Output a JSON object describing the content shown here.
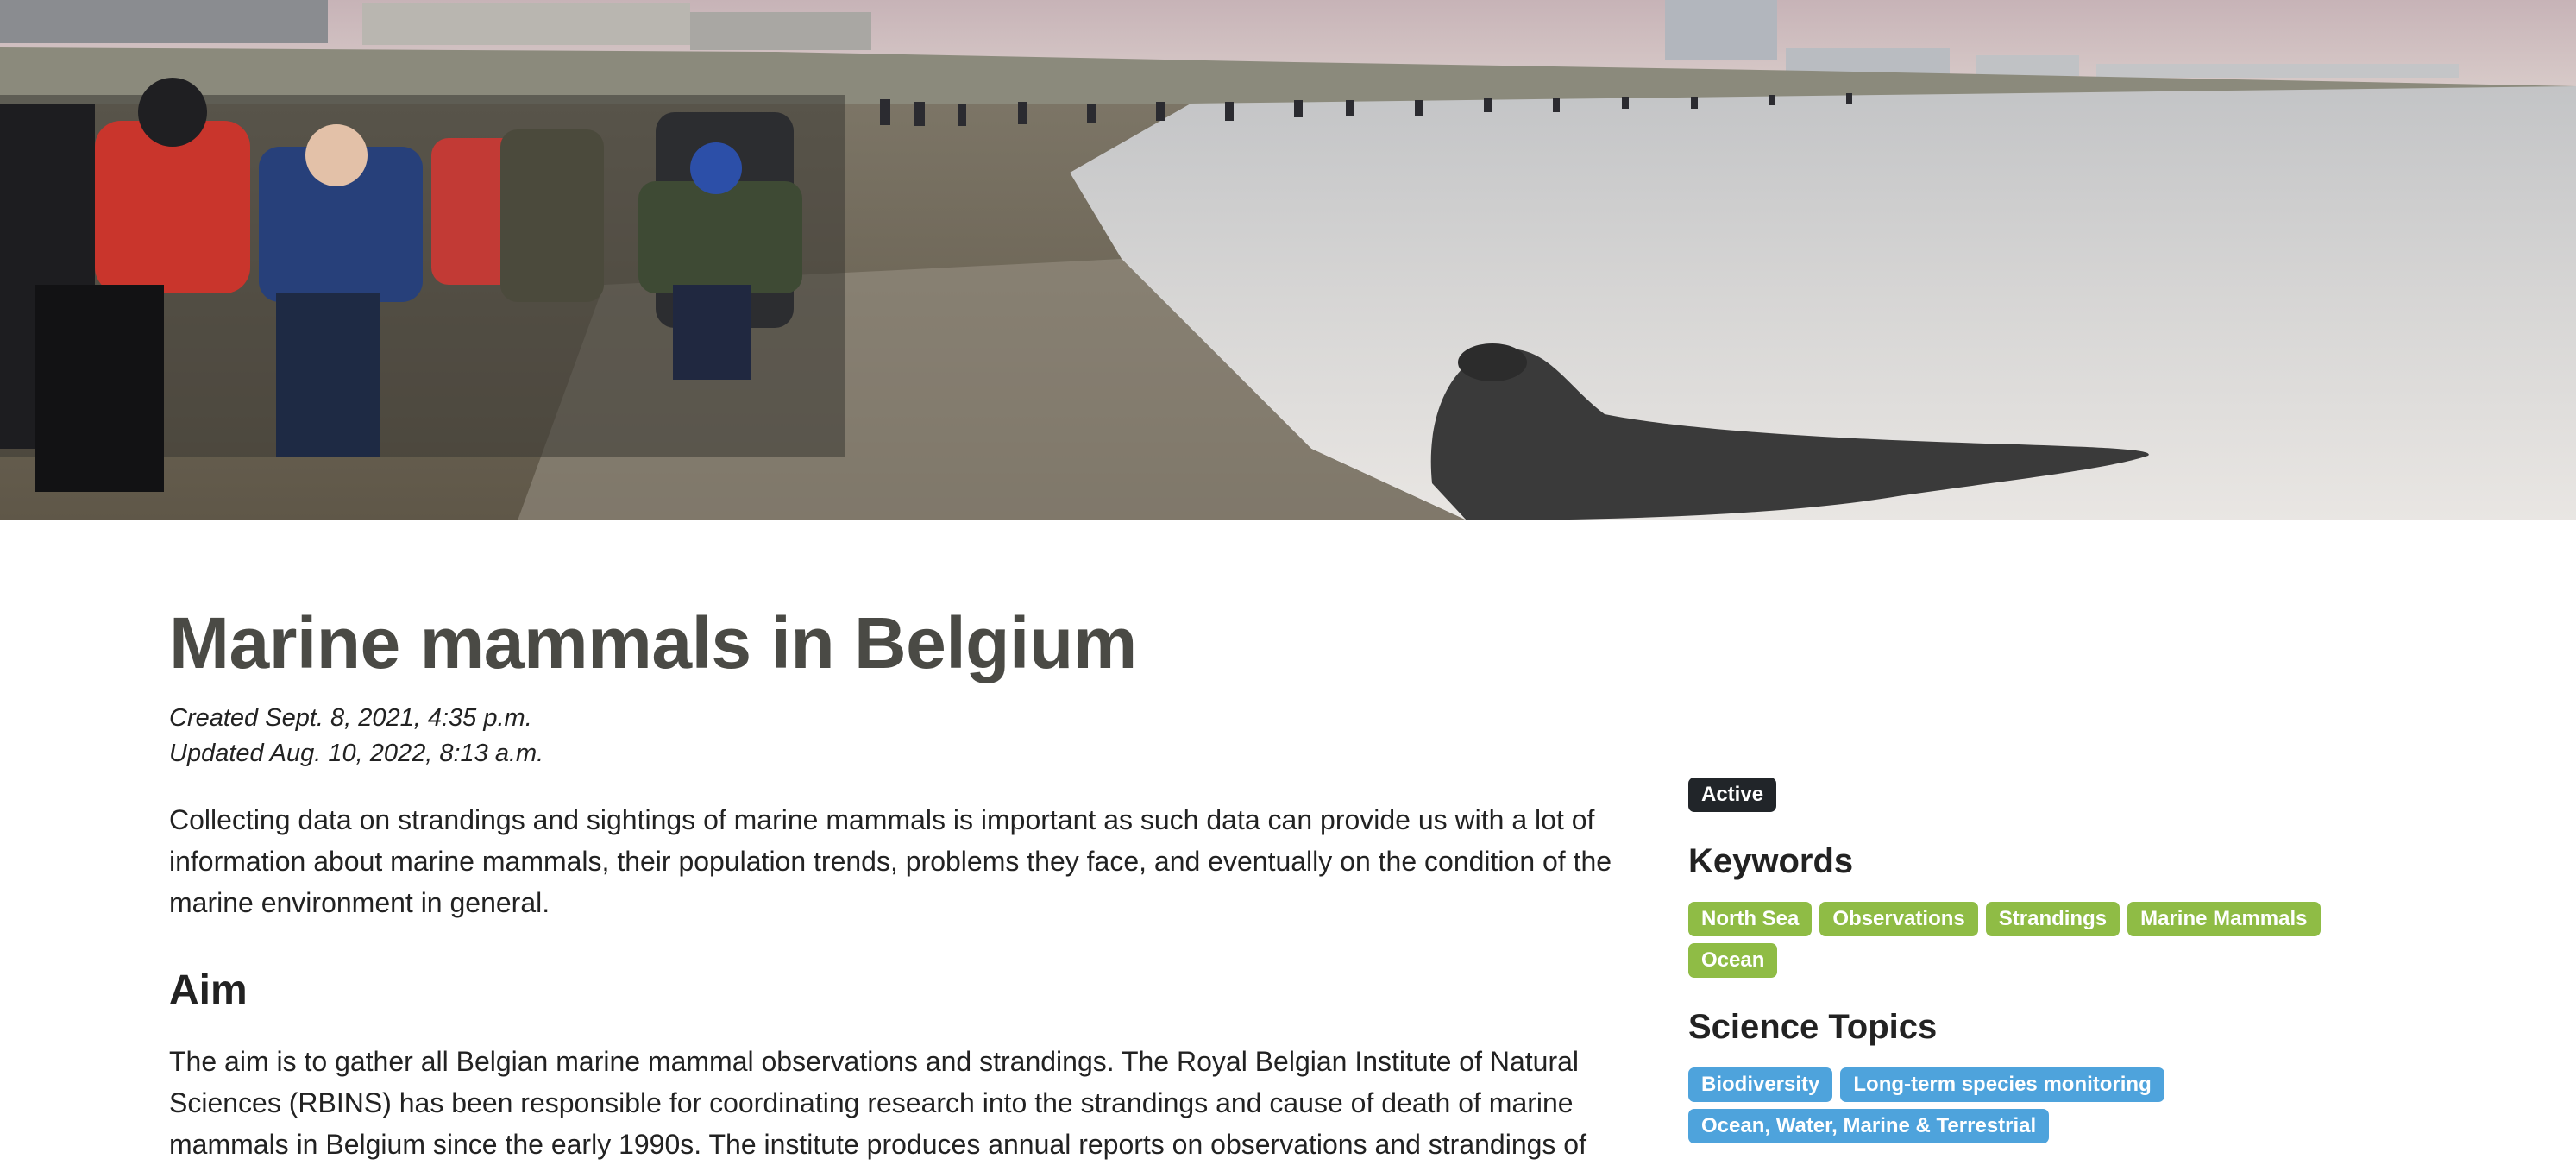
{
  "hero": {
    "image": "beach-seal-crowd-photo"
  },
  "article": {
    "title": "Marine mammals in Belgium",
    "created": "Created Sept. 8, 2021, 4:35 p.m.",
    "updated": "Updated Aug. 10, 2022, 8:13 a.m.",
    "intro": "Collecting data on strandings and sightings of marine mammals is important as such data can provide us with a lot of information about marine mammals, their population trends, problems they face, and eventually on the condition of the marine environment in general.",
    "aim_heading": "Aim",
    "aim_text": "The aim is to gather all Belgian marine mammal observations and strandings. The Royal Belgian Institute of Natural Sciences (RBINS) has been responsible for coordinating research into the strandings and cause of death of marine mammals in Belgium since the early 1990s. The institute produces annual reports on observations and strandings of"
  },
  "sidebar": {
    "status": "Active",
    "keywords_heading": "Keywords",
    "keywords": [
      "North Sea",
      "Observations",
      "Strandings",
      "Marine Mammals",
      "Ocean"
    ],
    "topics_heading": "Science Topics",
    "topics": [
      "Biodiversity",
      "Long-term species monitoring",
      "Ocean, Water, Marine & Terrestrial"
    ],
    "colors": {
      "keyword_tag": "#8fbc45",
      "topic_tag": "#4ea3dc",
      "status_badge": "#212529"
    }
  }
}
